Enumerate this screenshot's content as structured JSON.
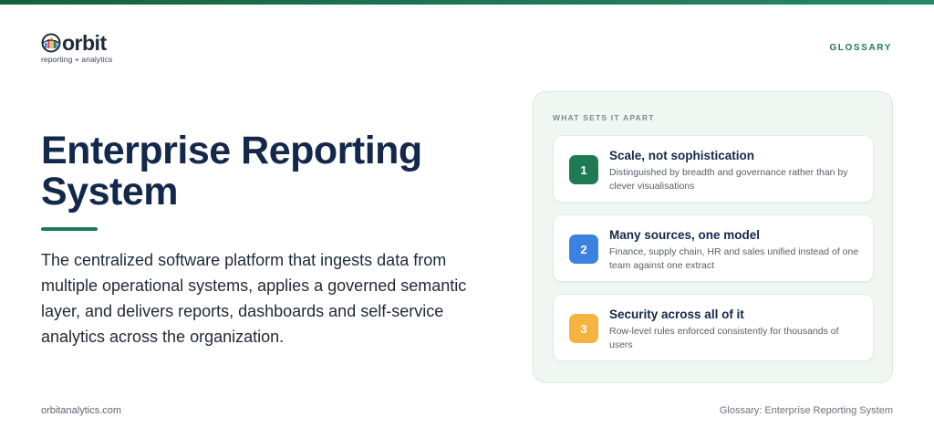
{
  "brand": {
    "name": "orbit",
    "tagline": "reporting + analytics",
    "accent": "#1e7a52",
    "navy": "#14284b"
  },
  "header": {
    "section_tag": "GLOSSARY"
  },
  "main": {
    "title": "Enterprise Reporting System",
    "definition": "The centralized software platform that ingests data from multiple operational systems, applies a governed semantic layer, and delivers reports, dashboards and self-service analytics across the organization."
  },
  "panel": {
    "label": "WHAT SETS IT APART",
    "items": [
      {
        "number": "1",
        "title": "Scale, not sophistication",
        "description": "Distinguished by breadth and governance rather than by clever visualisations",
        "color": "#1e7a52"
      },
      {
        "number": "2",
        "title": "Many sources, one model",
        "description": "Finance, supply chain, HR and sales unified instead of one team against one extract",
        "color": "#3b82e0"
      },
      {
        "number": "3",
        "title": "Security across all of it",
        "description": "Row-level rules enforced consistently for thousands of users",
        "color": "#f5b342"
      }
    ]
  },
  "footer": {
    "website": "orbitanalytics.com",
    "page_label": "Glossary: Enterprise Reporting System"
  }
}
